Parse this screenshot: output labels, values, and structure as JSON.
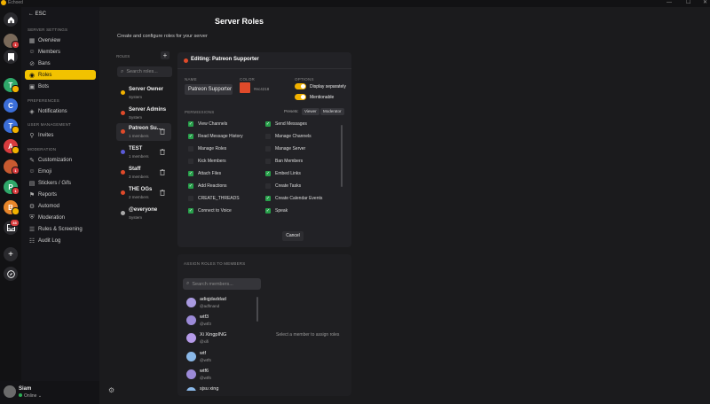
{
  "titlebar": {
    "app": "Echoed",
    "min": "—",
    "max": "☐",
    "close": "✕"
  },
  "rail": {
    "home_icon": "home-icon",
    "bookmark_icon": "bookmark-icon",
    "servers": [
      {
        "letter": "",
        "color": "#7a6a5a",
        "badge": "1",
        "badge_color": "#d83c3e"
      },
      {
        "letter": "T",
        "color": "#2fa86a",
        "badge": "",
        "badge_color": "#f2b200"
      },
      {
        "letter": "C",
        "color": "#3b6ed8",
        "badge": "",
        "badge_color": ""
      },
      {
        "letter": "T",
        "color": "#3b6ed8",
        "badge": "",
        "badge_color": "#f2b200"
      },
      {
        "letter": "A",
        "color": "#d83c3e",
        "badge": "",
        "badge_color": "#f2b200"
      },
      {
        "letter": "",
        "color": "#c85a30",
        "badge": "1",
        "badge_color": "#d83c3e"
      },
      {
        "letter": "P",
        "color": "#2fa86a",
        "badge": "1",
        "badge_color": "#d83c3e"
      },
      {
        "letter": "B",
        "color": "#e8862a",
        "badge": "",
        "badge_color": "#f2b200"
      }
    ],
    "inbox_badge": "33",
    "add_label": "+",
    "explore_icon": "compass-icon"
  },
  "sidebar": {
    "back": "ESC",
    "sections": [
      "SERVER SETTINGS",
      "PREFERENCES",
      "USER MANAGEMENT",
      "MODERATION"
    ],
    "items": [
      {
        "label": "Overview",
        "icon": "▦"
      },
      {
        "label": "Members",
        "icon": "☺"
      },
      {
        "label": "Bans",
        "icon": "⊘"
      },
      {
        "label": "Roles",
        "icon": "◉"
      },
      {
        "label": "Bots",
        "icon": "▣"
      },
      {
        "label": "Notifications",
        "icon": "◈"
      },
      {
        "label": "Invites",
        "icon": "⚲"
      },
      {
        "label": "Customization",
        "icon": "✎"
      },
      {
        "label": "Emoji",
        "icon": "☺"
      },
      {
        "label": "Stickers / Gifs",
        "icon": "▤"
      },
      {
        "label": "Reports",
        "icon": "⚑"
      },
      {
        "label": "Automod",
        "icon": "⚙"
      },
      {
        "label": "Moderation",
        "icon": "⛨"
      },
      {
        "label": "Rules & Screening",
        "icon": "☰"
      },
      {
        "label": "Audit Log",
        "icon": "☷"
      }
    ]
  },
  "user": {
    "name": "Siam",
    "status": "Online",
    "chevron": "⌄",
    "gear": "⚙"
  },
  "page": {
    "title": "Server Roles",
    "subtitle": "Create and configure roles for your server"
  },
  "roles_panel": {
    "header": "ROLES",
    "add": "+",
    "search_placeholder": "Search roles...",
    "roles": [
      {
        "name": "Server Owner",
        "sub": "System",
        "color": "#f2b200",
        "trash": false
      },
      {
        "name": "Server Admins",
        "sub": "System",
        "color": "#e04a2a",
        "trash": false
      },
      {
        "name": "Patreon Su...",
        "sub": "1 members",
        "color": "#e04a2a",
        "trash": true
      },
      {
        "name": "TEST",
        "sub": "1 members",
        "color": "#5a5ad8",
        "trash": true
      },
      {
        "name": "Staff",
        "sub": "3 members",
        "color": "#e04a2a",
        "trash": true
      },
      {
        "name": "THE OGs",
        "sub": "2 members",
        "color": "#e04a2a",
        "trash": true
      },
      {
        "name": "@everyone",
        "sub": "System",
        "color": "#aaaaaa",
        "trash": false
      }
    ]
  },
  "editor": {
    "title": "Editing: Patreon Supporter",
    "name_label": "NAME",
    "name_value": "Patreon Supporter",
    "color_label": "COLOR",
    "color_hex": "#ec4218",
    "color_value": "#e04a2a",
    "options_label": "OPTIONS",
    "options": [
      "Display separately",
      "Mentionable"
    ],
    "permissions_label": "PERMISSIONS",
    "presets_label": "Presets:",
    "presets": [
      "Viewer",
      "Moderator"
    ],
    "perms_left": [
      {
        "label": "View Channels",
        "on": true
      },
      {
        "label": "Read Message History",
        "on": true
      },
      {
        "label": "Manage Roles",
        "on": false
      },
      {
        "label": "Kick Members",
        "on": false
      },
      {
        "label": "Attach Files",
        "on": true
      },
      {
        "label": "Add Reactions",
        "on": true
      },
      {
        "label": "CREATE_THREADS",
        "on": false
      },
      {
        "label": "Connect to Voice",
        "on": true
      }
    ],
    "perms_right": [
      {
        "label": "Send Messages",
        "on": true
      },
      {
        "label": "Manage Channels",
        "on": false
      },
      {
        "label": "Manage Server",
        "on": false
      },
      {
        "label": "Ban Members",
        "on": false
      },
      {
        "label": "Embed Links",
        "on": true
      },
      {
        "label": "Create Tasks",
        "on": false
      },
      {
        "label": "Create Calendar Events",
        "on": true
      },
      {
        "label": "Speak",
        "on": true
      }
    ],
    "cancel": "Cancel"
  },
  "assign": {
    "title": "ASSIGN ROLES TO MEMBERS",
    "search_placeholder": "Search members...",
    "members": [
      {
        "name": "adiqjdaddad",
        "handle": "@adfmand"
      },
      {
        "name": "wtf3",
        "handle": "@wtf3"
      },
      {
        "name": "Xi XingpING",
        "handle": "@xifi"
      },
      {
        "name": "wtf",
        "handle": "@wtf5"
      },
      {
        "name": "wtf6",
        "handle": "@wtf6"
      },
      {
        "name": "sjsu xing",
        "handle": ""
      }
    ],
    "hint": "Select a member to assign roles"
  }
}
